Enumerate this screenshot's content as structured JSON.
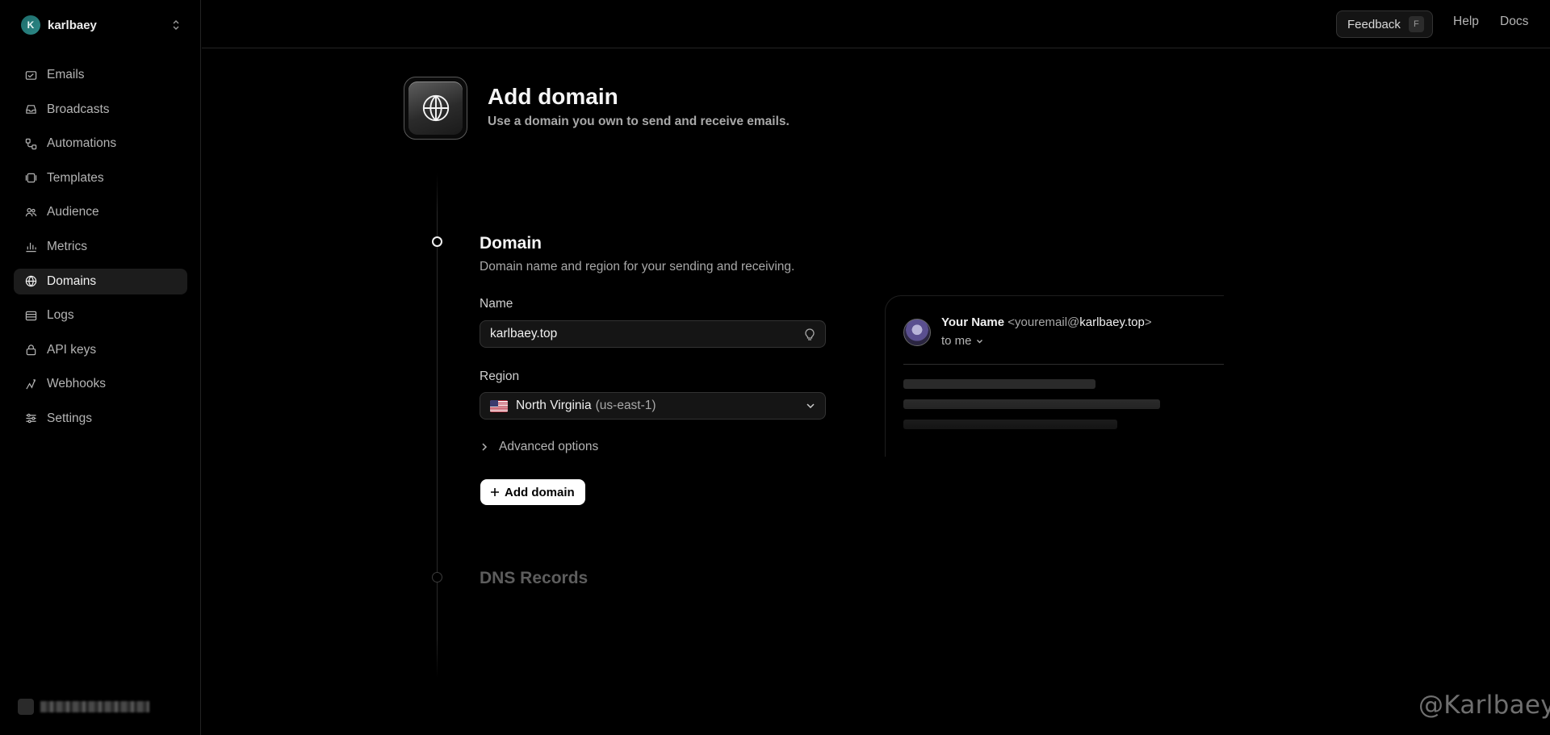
{
  "sidebar": {
    "team": {
      "initial": "K",
      "name": "karlbaey"
    },
    "items": [
      {
        "label": "Emails",
        "icon": "mail-icon",
        "active": false
      },
      {
        "label": "Broadcasts",
        "icon": "inbox-icon",
        "active": false
      },
      {
        "label": "Automations",
        "icon": "workflow-icon",
        "active": false
      },
      {
        "label": "Templates",
        "icon": "template-icon",
        "active": false
      },
      {
        "label": "Audience",
        "icon": "users-icon",
        "active": false
      },
      {
        "label": "Metrics",
        "icon": "bar-chart-icon",
        "active": false
      },
      {
        "label": "Domains",
        "icon": "globe-icon",
        "active": true
      },
      {
        "label": "Logs",
        "icon": "logs-icon",
        "active": false
      },
      {
        "label": "API keys",
        "icon": "lock-icon",
        "active": false
      },
      {
        "label": "Webhooks",
        "icon": "webhook-icon",
        "active": false
      },
      {
        "label": "Settings",
        "icon": "sliders-icon",
        "active": false
      }
    ]
  },
  "topbar": {
    "feedback_label": "Feedback",
    "feedback_shortcut": "F",
    "help_label": "Help",
    "docs_label": "Docs"
  },
  "header": {
    "title": "Add domain",
    "subtitle": "Use a domain you own to send and receive emails."
  },
  "domain_section": {
    "title": "Domain",
    "description": "Domain name and region for your sending and receiving.",
    "name_label": "Name",
    "name_value": "karlbaey.top",
    "region_label": "Region",
    "region_name": "North Virginia",
    "region_code": "(us-east-1)",
    "advanced_label": "Advanced options",
    "add_button_label": "Add domain"
  },
  "dns_section": {
    "title": "DNS Records"
  },
  "preview": {
    "sender_name": "Your Name",
    "addr_prefix": "<youremail@",
    "addr_domain": "karlbaey.top",
    "addr_suffix": ">",
    "to_label": "to me"
  },
  "watermark": "@Karlbaey",
  "colors": {
    "background": "#000000",
    "active_nav": "#1c1c1c",
    "primary_button": "#ffffff",
    "team_avatar": "#1d6b6a"
  }
}
